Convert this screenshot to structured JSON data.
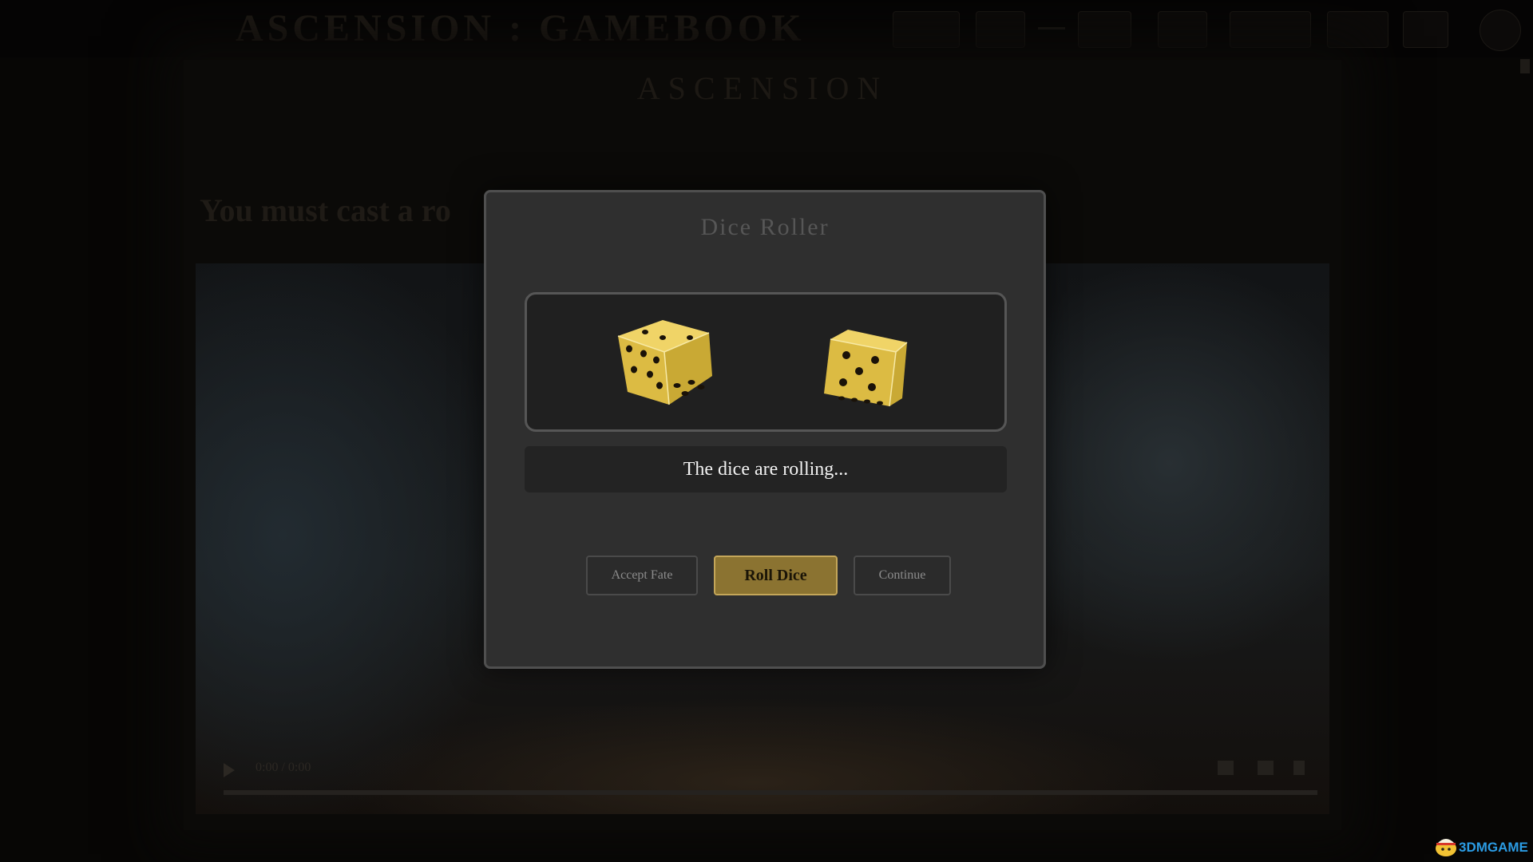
{
  "background_page": {
    "title": "ASCENSION : GAMEBOOK",
    "heading": "ASCENSION",
    "story_text": "You must cast a ro",
    "video_time": "0:00 / 0:00"
  },
  "modal": {
    "title": "Dice Roller",
    "status_text": "The dice are rolling...",
    "dice": [
      {
        "visible_pips": [
          6,
          4
        ]
      },
      {
        "visible_pips": [
          5,
          4
        ]
      }
    ],
    "buttons": {
      "accept_label": "Accept Fate",
      "roll_label": "Roll Dice",
      "continue_label": "Continue"
    }
  },
  "colors": {
    "dice_gold": "#e3c34a",
    "primary_button": "#8b7331",
    "modal_background": "#2f2f2f"
  },
  "watermark": {
    "text": "3DMGAME"
  }
}
